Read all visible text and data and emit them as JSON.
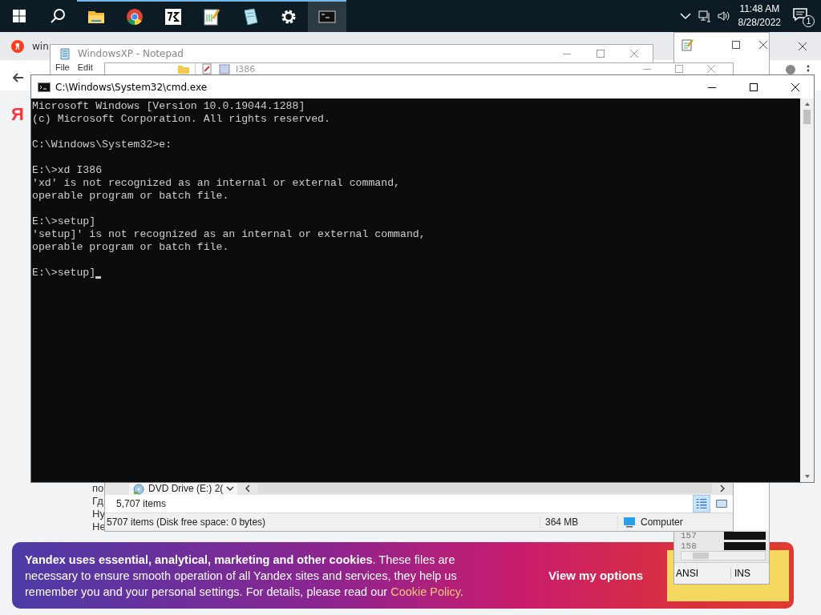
{
  "taskbar": {
    "apps": [
      {
        "kind": "search",
        "selected": false
      },
      {
        "kind": "folder",
        "selected": true
      },
      {
        "kind": "browser",
        "selected": true
      },
      {
        "kind": "archive",
        "selected": true
      },
      {
        "kind": "notepad",
        "selected": true
      },
      {
        "kind": "notebook",
        "selected": true
      },
      {
        "kind": "settings",
        "selected": true
      },
      {
        "kind": "terminal",
        "selected": true
      }
    ],
    "time": "11:48 AM",
    "date": "8/28/2022",
    "notifications": "1"
  },
  "browser": {
    "tab": "win",
    "page_lines": [
      "по",
      "Гд",
      "Ну",
      "Не"
    ],
    "logo": "Я"
  },
  "notepad": {
    "title": "WindowsXP - Notepad",
    "menu": [
      "File",
      "Edit"
    ]
  },
  "explorer": {
    "title": "I386",
    "address": "DVD Drive (E:) 2(",
    "items": "5,707 items",
    "status": "5707 items (Disk free space: 0 bytes)",
    "size": "364 MB",
    "zone": "Computer"
  },
  "hex_window": {
    "rows": [
      "157",
      "158"
    ],
    "encoding": "ANSI",
    "mode": "INS"
  },
  "cmd": {
    "title": "C:\\Windows\\System32\\cmd.exe",
    "blocks": [
      [
        "Microsoft Windows [Version 10.0.19044.1288]",
        "(c) Microsoft Corporation. All rights reserved."
      ],
      [
        "C:\\Windows\\System32>e:"
      ],
      [
        "E:\\>xd I386",
        "'xd' is not recognized as an internal or external command,",
        "operable program or batch file."
      ],
      [
        "E:\\>setup]",
        "'setup]' is not recognized as an internal or external command,",
        "operable program or batch file."
      ],
      [
        "E:\\>setup]"
      ]
    ],
    "cursor": true
  },
  "cookie_banner": {
    "text": "**Yandex uses essential, analytical, marketing and other cookies**. These files are necessary to ensure smooth operation of all Yandex sites and services, they help us remember you and your personal settings. For details, please read our",
    "link": "Cookie Policy",
    "after": ".",
    "button": "View my options"
  }
}
